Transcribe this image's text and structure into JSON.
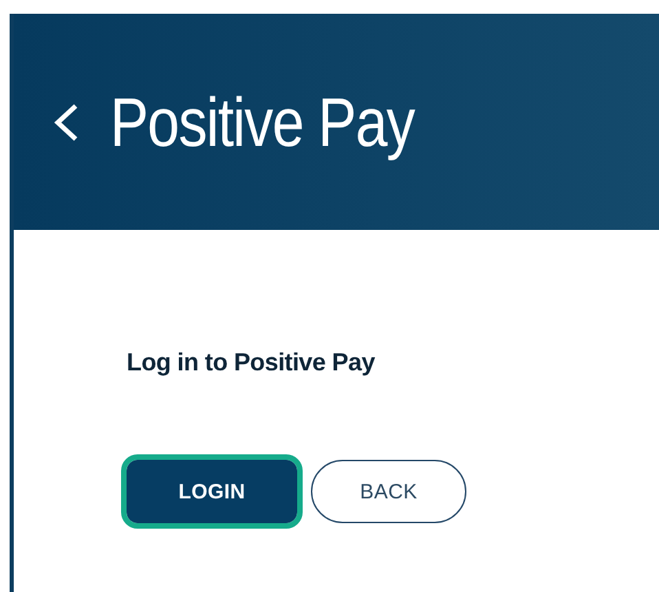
{
  "header": {
    "title": "Positive Pay"
  },
  "heading": "Log in to Positive Pay",
  "buttons": [
    {
      "label": "LOGIN",
      "kind": "primary",
      "focused": true
    },
    {
      "label": "BACK",
      "kind": "secondary",
      "focused": false
    }
  ]
}
